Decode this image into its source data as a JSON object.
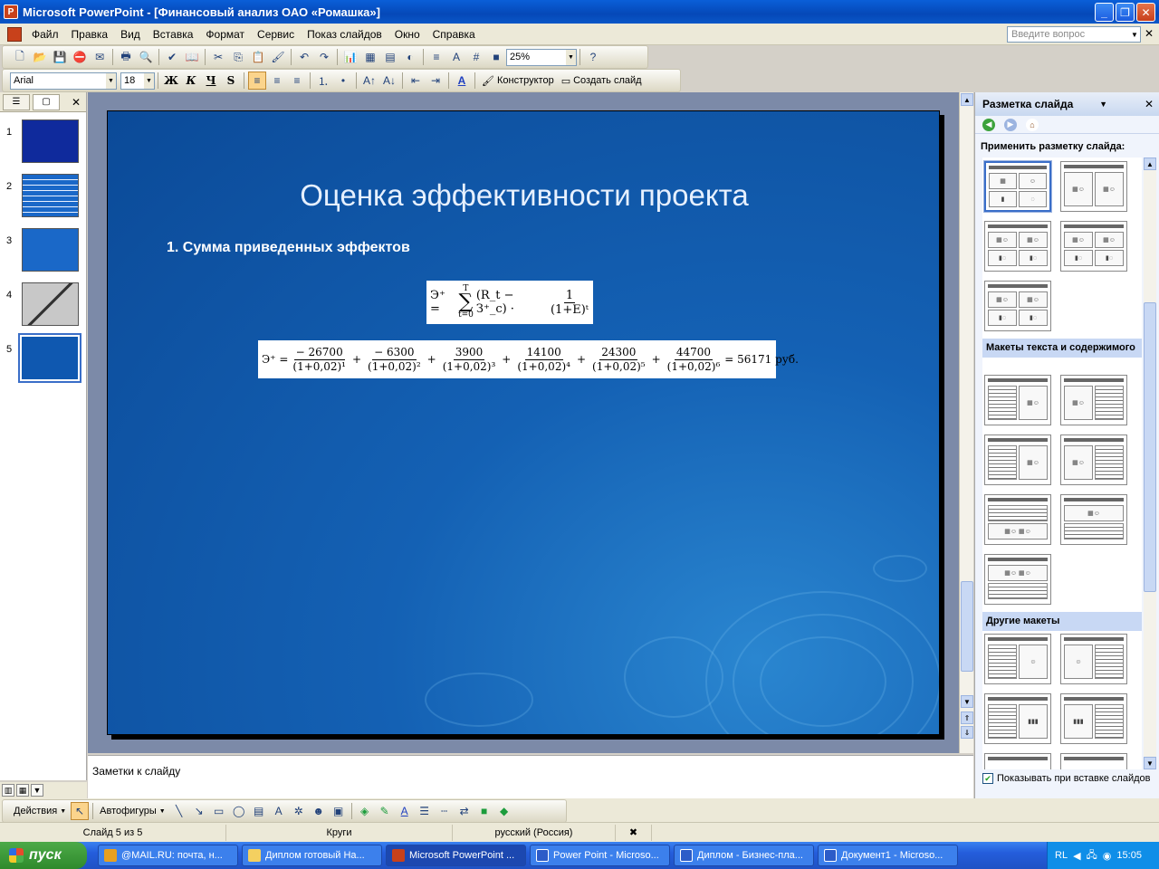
{
  "window": {
    "title": "Microsoft PowerPoint - [Финансовый анализ ОАО «Ромашка»]"
  },
  "menu": {
    "items": [
      "Файл",
      "Правка",
      "Вид",
      "Вставка",
      "Формат",
      "Сервис",
      "Показ слайдов",
      "Окно",
      "Справка"
    ],
    "ask_placeholder": "Введите вопрос"
  },
  "toolbar": {
    "zoom": "25%",
    "font": "Arial",
    "font_size": "18",
    "bold": "Ж",
    "italic": "К",
    "underline": "Ч",
    "shadow": "S",
    "designer": "Конструктор",
    "new_slide": "Создать слайд"
  },
  "slides": {
    "items": [
      {
        "num": "1",
        "color": "#0f2a9c"
      },
      {
        "num": "2",
        "color": "#1a68c8"
      },
      {
        "num": "3",
        "color": "#1a68c8"
      },
      {
        "num": "4",
        "color": "#3a4a70"
      },
      {
        "num": "5",
        "color": "#0f58b0"
      }
    ]
  },
  "slide": {
    "title": "Оценка эффективности проекта",
    "bullet": "1. Сумма приведенных эффектов",
    "formula1": {
      "lhs": "Э⁺ =",
      "sum_top": "T",
      "sum_bottom": "t=0",
      "term": "(R_t − З⁺_c) ·",
      "num": "1",
      "den": "(1+E)ᵗ"
    },
    "formula2": {
      "lhs": "Э⁺ =",
      "terms": [
        {
          "num": "− 26700",
          "den": "(1+0,02)¹"
        },
        {
          "num": "− 6300",
          "den": "(1+0,02)²"
        },
        {
          "num": "3900",
          "den": "(1+0,02)³"
        },
        {
          "num": "14100",
          "den": "(1+0,02)⁴"
        },
        {
          "num": "24300",
          "den": "(1+0,02)⁵"
        },
        {
          "num": "44700",
          "den": "(1+0,02)⁶"
        }
      ],
      "result": "= 56171 руб."
    }
  },
  "notes": {
    "placeholder": "Заметки к слайду"
  },
  "taskpane": {
    "title": "Разметка слайда",
    "apply_label": "Применить разметку слайда:",
    "section_text_content": "Макеты текста и содержимого",
    "section_other": "Другие макеты",
    "show_on_insert": "Показывать при вставке слайдов"
  },
  "drawing": {
    "actions": "Действия",
    "autoshapes": "Автофигуры"
  },
  "status": {
    "slide": "Слайд 5 из 5",
    "design": "Круги",
    "language": "русский (Россия)"
  },
  "taskbar": {
    "start": "пуск",
    "tasks": [
      {
        "label": "@MAIL.RU: почта, н...",
        "color": "#e8a020"
      },
      {
        "label": "Диплом готовый На...",
        "color": "#f4d060"
      },
      {
        "label": "Microsoft PowerPoint ...",
        "color": "#c8411b"
      },
      {
        "label": "Power Point - Microso...",
        "color": "#2c5cc8"
      },
      {
        "label": "Диплом - Бизнес-пла...",
        "color": "#2c5cc8"
      },
      {
        "label": "Документ1 - Microso...",
        "color": "#2c5cc8"
      }
    ],
    "lang": "RL",
    "time": "15:05"
  }
}
